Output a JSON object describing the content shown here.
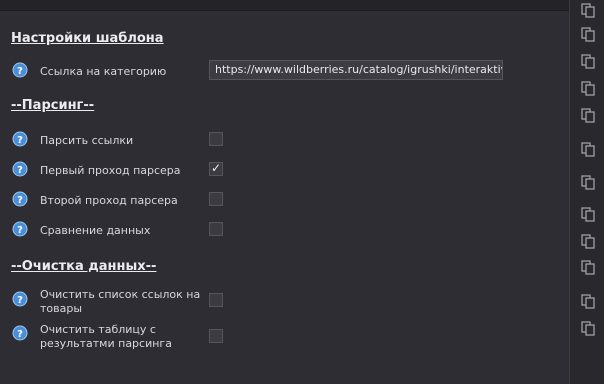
{
  "settings": {
    "title": "Настройки шаблона",
    "category_link_label": "Ссылка на категорию",
    "category_link_value": "https://www.wildberries.ru/catalog/igrushki/interaktivnye"
  },
  "parsing": {
    "title": "--Парсинг--",
    "items": [
      {
        "label": "Парсить ссылки",
        "checked": false
      },
      {
        "label": "Первый проход парсера",
        "checked": true
      },
      {
        "label": "Второй проход парсера",
        "checked": false
      },
      {
        "label": "Сравнение данных",
        "checked": false
      }
    ]
  },
  "cleanup": {
    "title": "--Очистка данных--",
    "items": [
      {
        "label_line1": "Очистить список ссылок на",
        "label_line2": "товары",
        "checked": false
      },
      {
        "label_line1": "Очистить таблицу с",
        "label_line2": "результатми парсинга",
        "checked": false
      }
    ]
  },
  "checkmark_glyph": "✓",
  "icons": {
    "help": "help-icon",
    "copy": "copy-icon"
  },
  "colors": {
    "background": "#2d2d33",
    "help_icon": "#4a8fd6",
    "text": "#e4e4e8"
  }
}
